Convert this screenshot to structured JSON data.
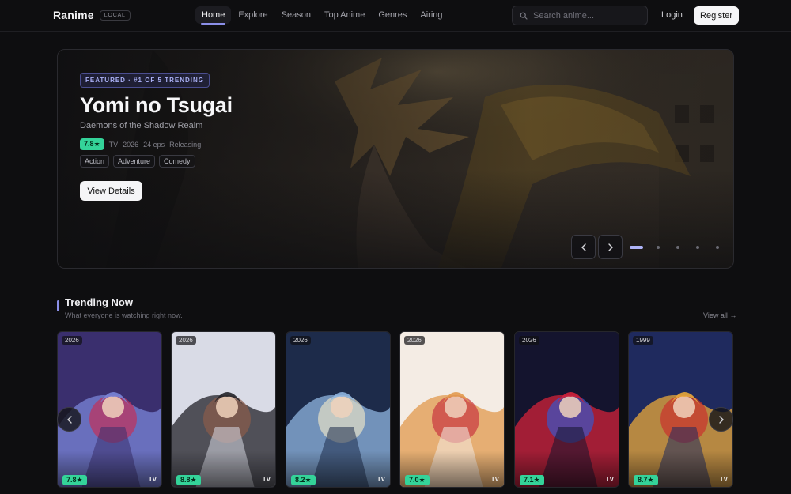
{
  "nav": {
    "brand": "Ranime",
    "badge": "LOCAL",
    "links": [
      {
        "label": "Home",
        "active": true
      },
      {
        "label": "Explore"
      },
      {
        "label": "Season"
      },
      {
        "label": "Top Anime"
      },
      {
        "label": "Genres"
      },
      {
        "label": "Airing"
      }
    ],
    "search_placeholder": "Search anime...",
    "login": "Login",
    "register": "Register"
  },
  "hero": {
    "badge": "FEATURED · #1 OF 5 TRENDING",
    "title": "Yomi no Tsugai",
    "subtitle": "Daemons of the Shadow Realm",
    "score": "7.8★",
    "meta": [
      "TV",
      "2026",
      "24 eps",
      "Releasing"
    ],
    "genres": [
      "Action",
      "Adventure",
      "Comedy"
    ],
    "button": "View Details",
    "slide_count": 5,
    "active_slide": 1
  },
  "trending": {
    "title": "Trending Now",
    "subtitle": "What everyone is watching right now.",
    "view_all": "View all →",
    "cards": [
      {
        "year": "2026",
        "score": "7.8★",
        "type": "TV",
        "colors": [
          "#3a2f6e",
          "#7a86d8",
          "#c2315a"
        ]
      },
      {
        "year": "2026",
        "score": "8.8★",
        "type": "TV",
        "colors": [
          "#d9dbe6",
          "#222228",
          "#8a5b4a"
        ]
      },
      {
        "year": "2026",
        "score": "8.2★",
        "type": "TV",
        "colors": [
          "#1d2b4a",
          "#8fb5e0",
          "#e6e1c8"
        ]
      },
      {
        "year": "2026",
        "score": "7.0★",
        "type": "TV",
        "colors": [
          "#f4ece4",
          "#e29a4e",
          "#c73640"
        ]
      },
      {
        "year": "2026",
        "score": "7.1★",
        "type": "TV",
        "colors": [
          "#14142e",
          "#d2213a",
          "#3a56c8"
        ]
      },
      {
        "year": "1999",
        "score": "8.7★",
        "type": "TV",
        "colors": [
          "#1f2a5e",
          "#e9a83a",
          "#c9322e"
        ]
      }
    ]
  }
}
